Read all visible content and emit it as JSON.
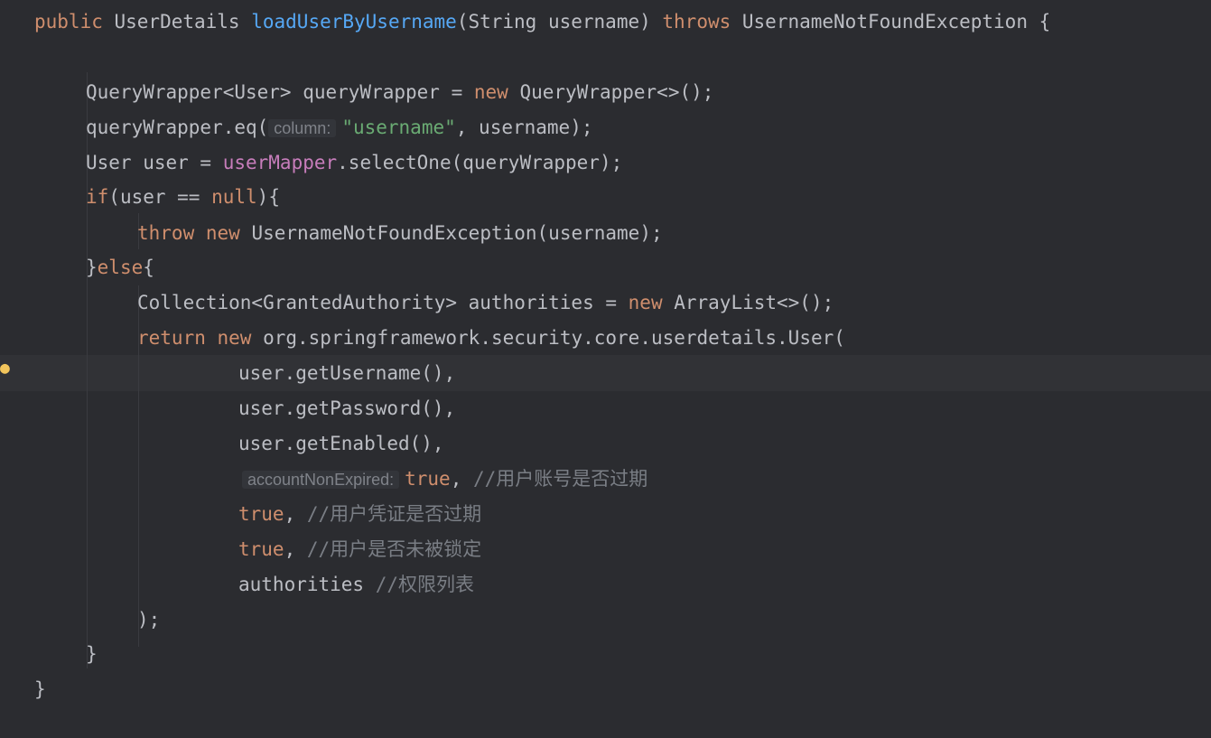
{
  "code": {
    "l1": {
      "a": "public",
      "b": " UserDetails ",
      "c": "loadUserByUsername",
      "d": "(String username) ",
      "e": "throws",
      "f": " UsernameNotFoundException {"
    },
    "l2": {
      "a": "QueryWrapper<User> queryWrapper = ",
      "b": "new",
      "c": " QueryWrapper<>();"
    },
    "l3": {
      "a": "queryWrapper.eq(",
      "hint": "column:",
      "b": "\"username\"",
      "c": ", username);"
    },
    "l4": {
      "a": "User user = ",
      "b": "userMapper",
      "c": ".selectOne(queryWrapper);"
    },
    "l5": {
      "a": "if",
      "b": "(user == ",
      "c": "null",
      "d": "){"
    },
    "l6": {
      "a": "throw",
      "b": " ",
      "c": "new",
      "d": " UsernameNotFoundException(username);"
    },
    "l7": {
      "a": "}",
      "b": "else",
      "c": "{"
    },
    "l8": {
      "a": "Collection<GrantedAuthority> authorities = ",
      "b": "new",
      "c": " ArrayList<>();"
    },
    "l9": {
      "a": "return",
      "b": " ",
      "c": "new",
      "d": " org.springframework.security.core.userdetails.User("
    },
    "l10": {
      "a": "user.getUsername(),"
    },
    "l11": {
      "a": "user.getPassword(),"
    },
    "l12": {
      "a": "user.getEnabled(),"
    },
    "l13": {
      "hint": "accountNonExpired:",
      "b": "true",
      "c": ", ",
      "d": "//用户账号是否过期"
    },
    "l14": {
      "b": "true",
      "c": ", ",
      "d": "//用户凭证是否过期"
    },
    "l15": {
      "b": "true",
      "c": ", ",
      "d": "//用户是否未被锁定"
    },
    "l16": {
      "a": "authorities ",
      "d": "//权限列表"
    },
    "l17": {
      "a": ");"
    },
    "l18": {
      "a": "}"
    },
    "l19": {
      "a": "}"
    }
  },
  "icons": {
    "bulb": "intention-bulb-icon"
  },
  "colors": {
    "background": "#2b2c30",
    "keyword": "#cf8e6d",
    "method": "#56a8f5",
    "field": "#c77dbb",
    "string": "#6aab73",
    "comment": "#7a7e85"
  }
}
